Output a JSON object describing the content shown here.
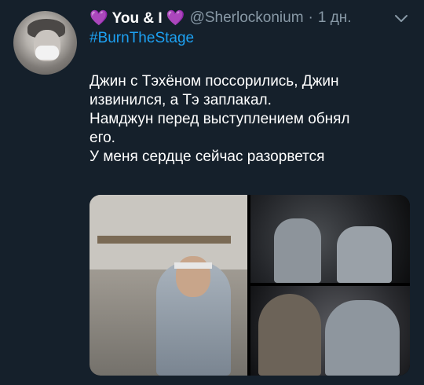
{
  "tweet": {
    "display_name": "💜 You & I 💜",
    "handle": "@Sherlockonium",
    "separator": "·",
    "time": "1 дн.",
    "hashtag": "#BurnTheStage",
    "lines": [
      "Джин с Тэхёном поссорились, Джин",
      "извинился, а Тэ заплакал.",
      "Намджун перед выступлением обнял",
      "его.",
      "У меня сердце сейчас разорвется"
    ],
    "icons": {
      "more": "chevron-down-icon"
    }
  },
  "colors": {
    "background": "#15202b",
    "link": "#1da1f2",
    "secondary_text": "#8899a6"
  }
}
